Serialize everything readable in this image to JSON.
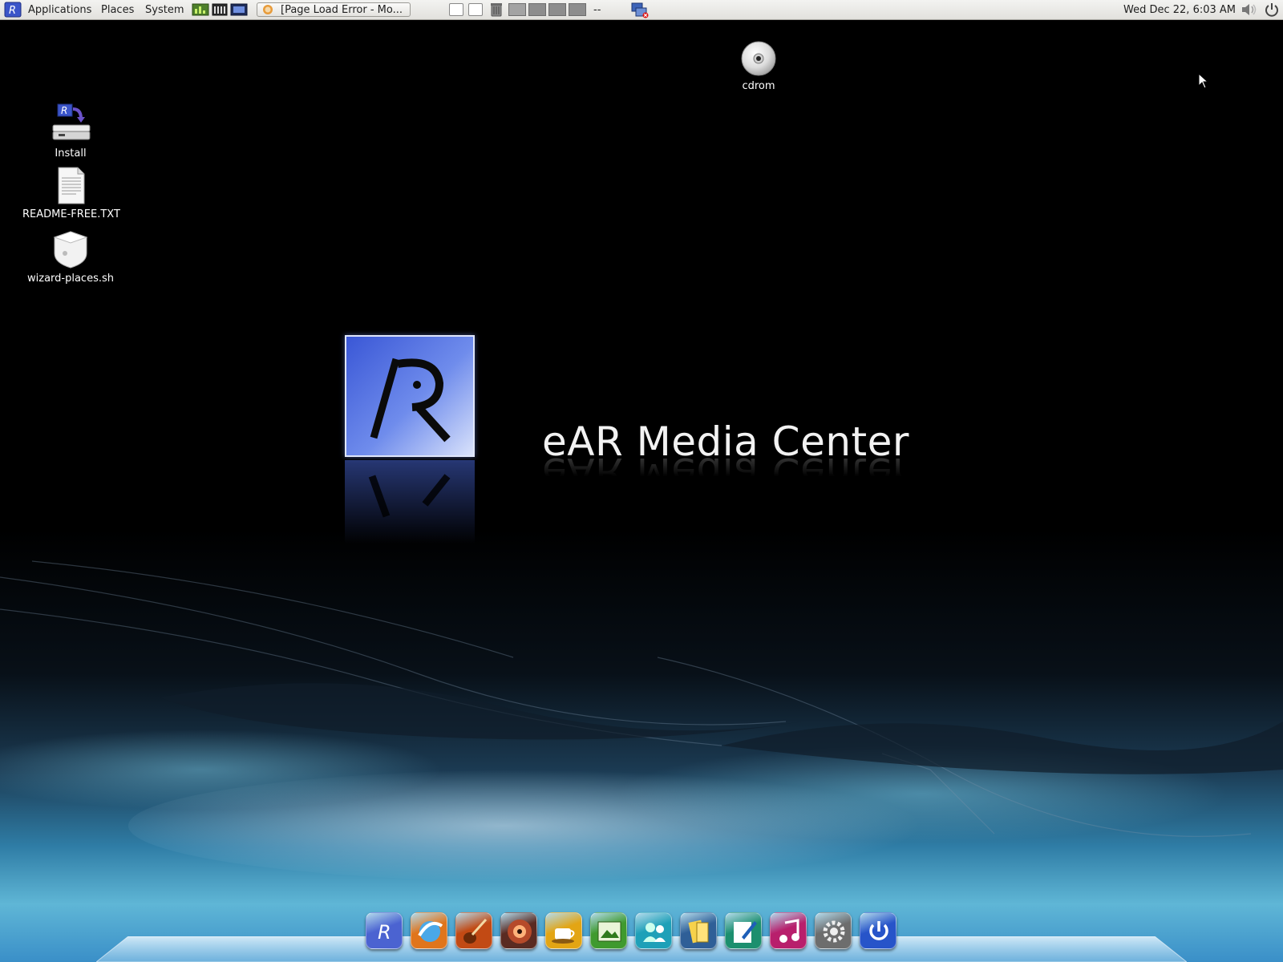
{
  "top_panel": {
    "menus": [
      "Applications",
      "Places",
      "System"
    ],
    "task_button": "[Page Load Error - Mo...",
    "workspace_sep": "--",
    "clock": "Wed Dec 22,  6:03 AM"
  },
  "desktop": {
    "icons": [
      {
        "label": "Install",
        "icon": "install-drive-icon"
      },
      {
        "label": "README-FREE.TXT",
        "icon": "text-file-icon"
      },
      {
        "label": "wizard-places.sh",
        "icon": "script-file-icon"
      },
      {
        "label": "cdrom",
        "icon": "cdrom-icon"
      }
    ]
  },
  "branding": {
    "logo_letter": "R",
    "title": "eAR Media Center"
  },
  "dock": {
    "items": [
      {
        "icon": "ear-menu-icon",
        "color": "#4b63d1"
      },
      {
        "icon": "web-browser-icon",
        "color": "#e0751c"
      },
      {
        "icon": "guitar-icon",
        "color": "#c24a14"
      },
      {
        "icon": "media-burner-icon",
        "color": "#5a2b22"
      },
      {
        "icon": "coffee-cup-icon",
        "color": "#e3a514"
      },
      {
        "icon": "image-viewer-icon",
        "color": "#3f9a2e"
      },
      {
        "icon": "messenger-icon",
        "color": "#1ea0b8"
      },
      {
        "icon": "office-icon",
        "color": "#2f5f97"
      },
      {
        "icon": "text-editor-icon",
        "color": "#1c8f6e"
      },
      {
        "icon": "music-player-icon",
        "color": "#b81f6c"
      },
      {
        "icon": "settings-icon",
        "color": "#6d6d6d"
      },
      {
        "icon": "power-icon",
        "color": "#2754c9"
      }
    ]
  },
  "colors": {
    "panel_bg": "#e9e8e4",
    "desktop_bg": "#000000",
    "accent": "#4b63d1"
  }
}
